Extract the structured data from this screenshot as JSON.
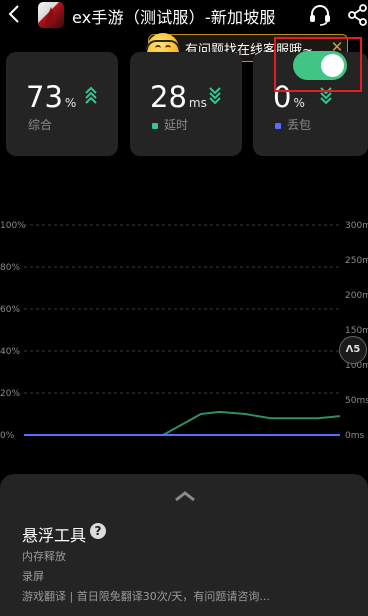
{
  "header": {
    "title": "ex手游（测试服）-新加坡服"
  },
  "bubble": {
    "text": "有问题找在线客服哦~",
    "close": "✕"
  },
  "stats": [
    {
      "value": "73",
      "unit": "%",
      "label": "综合",
      "trend": "up",
      "color": "#35c78c"
    },
    {
      "value": "28",
      "unit": "ms",
      "label": "延时",
      "trend": "down",
      "color": "#35c78c"
    },
    {
      "value": "0",
      "unit": "%",
      "label": "丢包",
      "trend": "down",
      "color": "#5a6bff"
    }
  ],
  "chart": {
    "left_ticks": [
      "100%",
      "80%",
      "60%",
      "40%",
      "20%",
      "0%"
    ],
    "right_ticks": [
      "300ms",
      "250ms",
      "200ms",
      "150ms",
      "100ms",
      "50ms",
      "0ms"
    ],
    "handle_label": "Λ5",
    "series": [
      {
        "color": "#2f8f62"
      },
      {
        "color": "#5a6bff"
      }
    ]
  },
  "panel": {
    "title": "悬浮工具",
    "help": "?",
    "options": [
      "内存释放",
      "录屏",
      "游戏翻译 | 首日限免翻译30次/天，有问题请咨询..."
    ],
    "toggle_on": true,
    "toggle_color": "#41c584",
    "highlight_color": "#e02020"
  },
  "chart_data": {
    "type": "line",
    "ylim_left": [
      0,
      100
    ],
    "ylim_right": [
      0,
      300
    ],
    "series": [
      {
        "points": [
          [
            0,
            0
          ],
          [
            44,
            0
          ],
          [
            50,
            5
          ],
          [
            56,
            10
          ],
          [
            62,
            11
          ],
          [
            70,
            10
          ],
          [
            78,
            8
          ],
          [
            86,
            8
          ],
          [
            93,
            8
          ],
          [
            100,
            9
          ]
        ]
      },
      {
        "points": [
          [
            0,
            0
          ],
          [
            100,
            0
          ]
        ]
      }
    ]
  }
}
